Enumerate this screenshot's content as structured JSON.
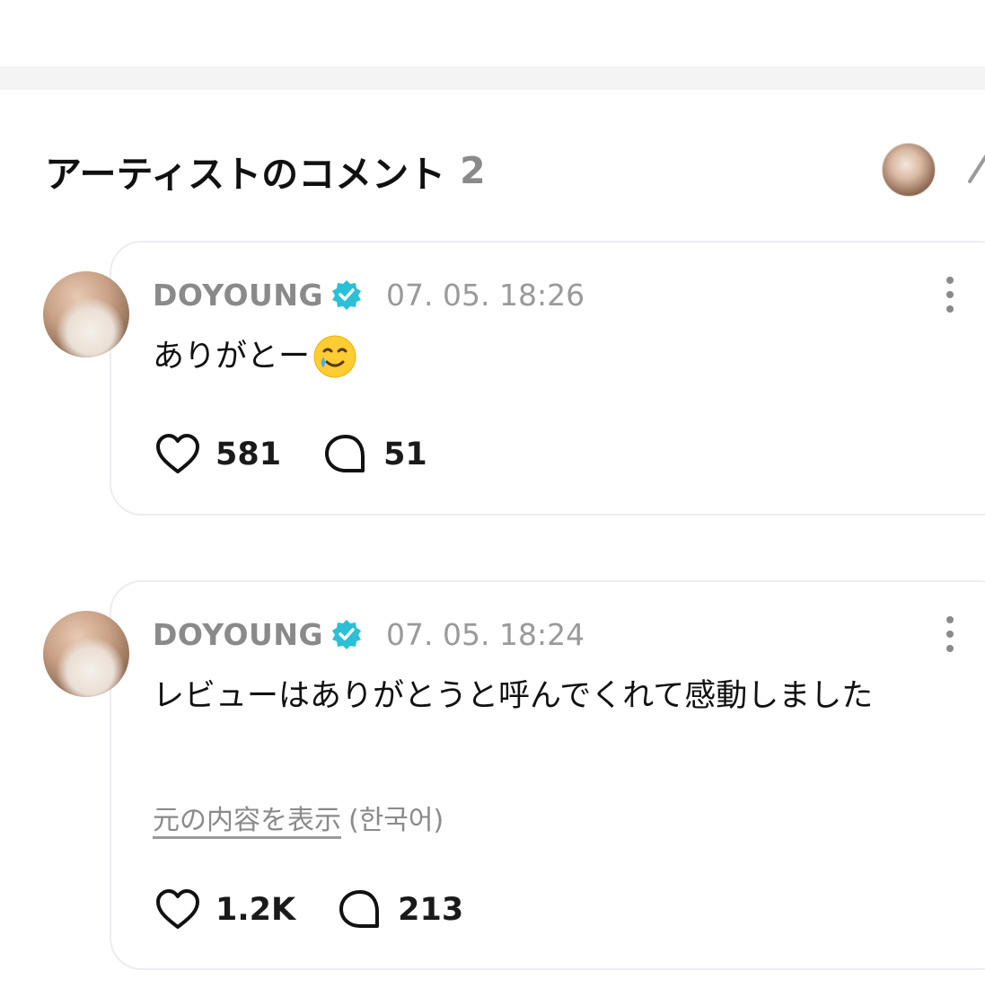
{
  "section": {
    "title": "アーティストのコメント",
    "count": "2"
  },
  "comments": [
    {
      "author": "DOYOUNG",
      "verified": true,
      "timestamp": "07. 05. 18:26",
      "text": "ありがとー",
      "emoji": "smiling-face-with-tear",
      "likes": "581",
      "replies": "51"
    },
    {
      "author": "DOYOUNG",
      "verified": true,
      "timestamp": "07. 05. 18:24",
      "text": "レビューはありがとうと呼んでくれて感動しました",
      "translation_link": "元の内容を表示",
      "translation_lang": "(한국어)",
      "likes": "1.2K",
      "replies": "213"
    }
  ],
  "colors": {
    "verified": "#2bc0d8",
    "muted_text": "#8a8a8a",
    "card_border": "#ececf2",
    "divider": "#f4f4f4"
  },
  "icons": [
    "more-vertical-icon",
    "verified-badge-icon",
    "heart-icon",
    "comment-bubble-icon",
    "avatar"
  ]
}
